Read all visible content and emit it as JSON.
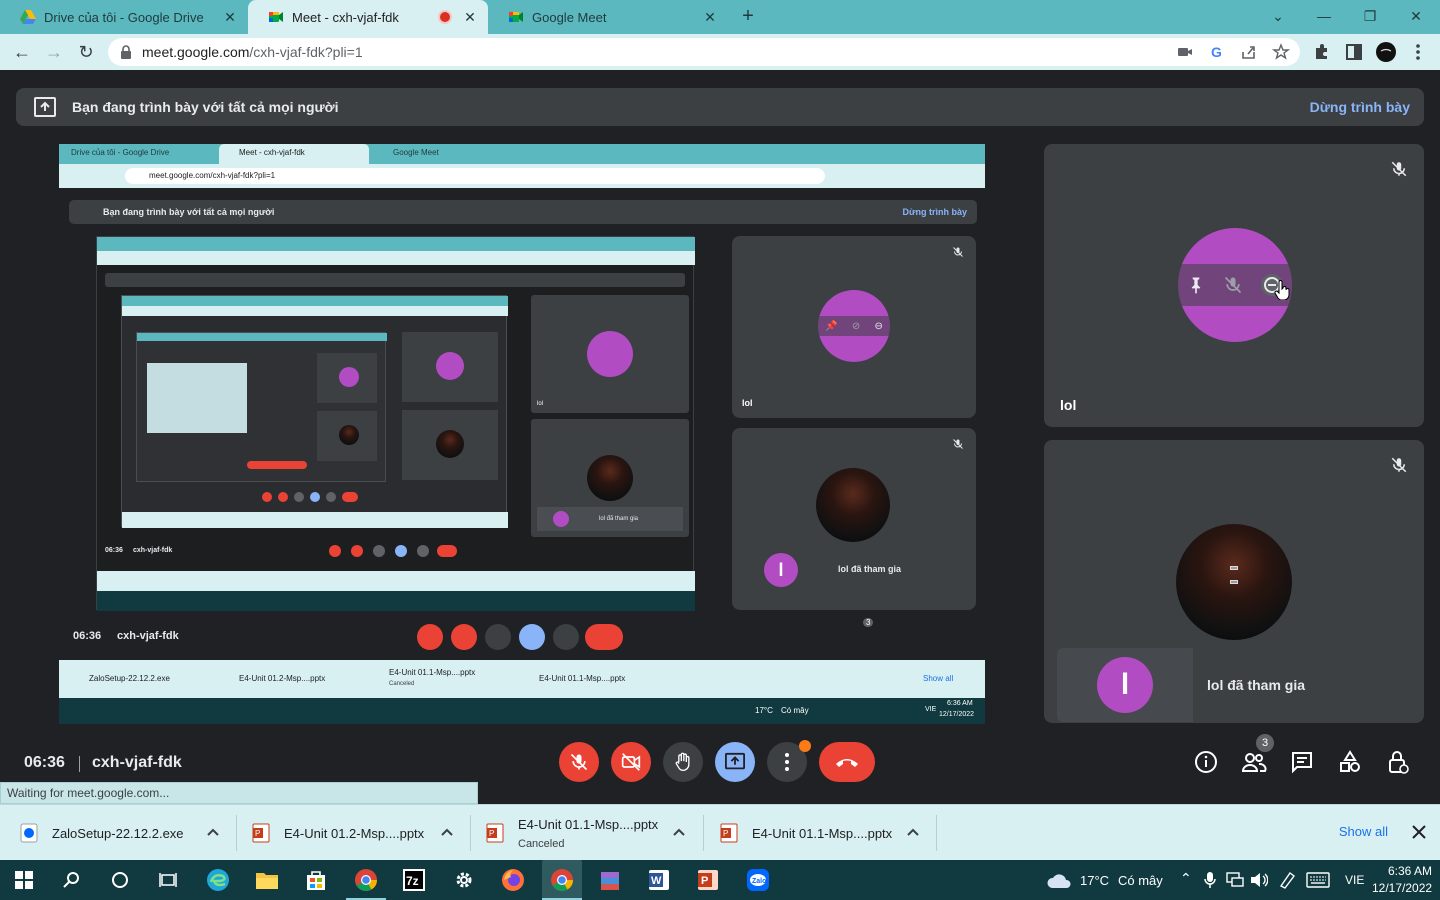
{
  "browser": {
    "tabs": [
      {
        "title": "Drive của tôi - Google Drive",
        "icon": "google-drive-icon",
        "active": false
      },
      {
        "title": "Meet - cxh-vjaf-fdk",
        "icon": "google-meet-icon",
        "active": true,
        "recording": true
      },
      {
        "title": "Google Meet",
        "icon": "google-meet-icon",
        "active": false
      }
    ],
    "new_tab_label": "+",
    "url": {
      "host": "meet.google.com",
      "path": "/cxh-vjaf-fdk?pli=1"
    }
  },
  "meet": {
    "banner": {
      "text": "Bạn đang trình bày với tất cả mọi người",
      "stop_label": "Dừng trình bày"
    },
    "participants": [
      {
        "name": "lol",
        "avatar": "purple-circle"
      },
      {
        "name": "",
        "avatar": "space-image"
      }
    ],
    "join_notice": {
      "initial": "l",
      "text": "lol đã tham gia"
    },
    "meeting_time": "06:36",
    "meeting_code": "cxh-vjaf-fdk",
    "people_count": "3",
    "status_text": "Waiting for meet.google.com...",
    "nested": {
      "tab1": "Drive của tôi - Google Drive",
      "tab2": "Meet - cxh-vjaf-fdk",
      "tab3": "Google Meet",
      "url": "meet.google.com/cxh-vjaf-fdk?pli=1",
      "banner": "Bạn đang trình bày với tất cả mọi người",
      "stop": "Dừng trình bày",
      "name": "lol",
      "join": "lol đã tham gia",
      "time": "06:36",
      "code": "cxh-vjaf-fdk",
      "people": "3",
      "dl1": "ZaloSetup-22.12.2.exe",
      "dl2": "E4-Unit 01.2-Msp....pptx",
      "dl3": "E4-Unit 01.1-Msp....pptx",
      "dl3_sub": "Canceled",
      "dl4": "E4-Unit 01.1-Msp....pptx",
      "show_all": "Show all",
      "temp": "17°C",
      "cond": "Có mây",
      "lang": "VIE",
      "clock": "6:36 AM",
      "date": "12/17/2022"
    }
  },
  "downloads": {
    "items": [
      {
        "name": "ZaloSetup-22.12.2.exe",
        "icon": "zalo-file-icon",
        "sub": ""
      },
      {
        "name": "E4-Unit 01.2-Msp....pptx",
        "icon": "pptx-file-icon",
        "sub": ""
      },
      {
        "name": "E4-Unit 01.1-Msp....pptx",
        "icon": "pptx-file-icon",
        "sub": "Canceled"
      },
      {
        "name": "E4-Unit 01.1-Msp....pptx",
        "icon": "pptx-file-icon",
        "sub": ""
      }
    ],
    "show_all": "Show all"
  },
  "taskbar": {
    "weather_temp": "17°C",
    "weather_cond": "Có mây",
    "language": "VIE",
    "time": "6:36 AM",
    "date": "12/17/2022"
  },
  "colors": {
    "tabbar": "#5cb8bf",
    "toolbar": "#d8f0f1",
    "meet_bg": "#202124",
    "tile_bg": "#3c4043",
    "red": "#ea4335",
    "blue": "#8ab4f8",
    "avatar_purple": "#b14cc2"
  }
}
